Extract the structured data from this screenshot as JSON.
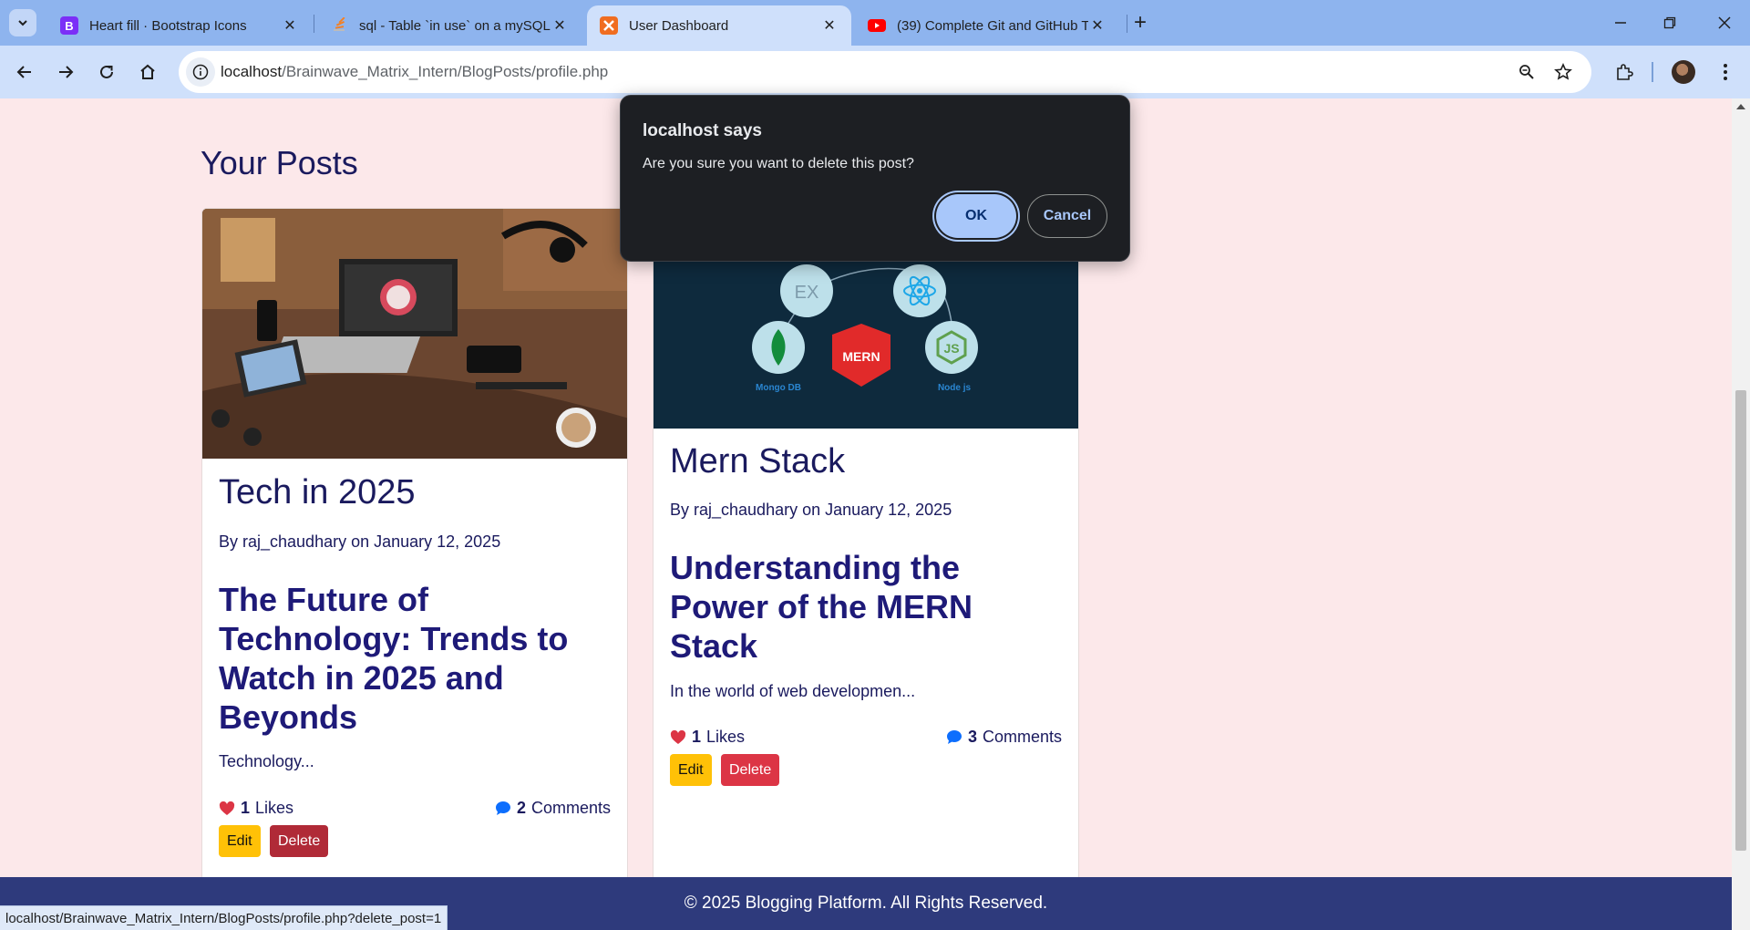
{
  "browser": {
    "tabs": [
      {
        "title": "Heart fill · Bootstrap Icons",
        "favicon": "bootstrap-icon",
        "favicon_letter": "B",
        "favicon_color": "#7b2ff7"
      },
      {
        "title": "sql - Table `in use` on a mySQL",
        "favicon": "stackoverflow-icon",
        "favicon_color": "#f48024"
      },
      {
        "title": "User Dashboard",
        "favicon": "xampp-icon",
        "favicon_color": "#f06d20",
        "active": true
      },
      {
        "title": "(39) Complete Git and GitHub T",
        "favicon": "youtube-icon",
        "favicon_color": "#ff0000"
      }
    ],
    "url_host": "localhost",
    "url_path": "/Brainwave_Matrix_Intern/BlogPosts/profile.php",
    "status_url": "localhost/Brainwave_Matrix_Intern/BlogPosts/profile.php?delete_post=1"
  },
  "page": {
    "section_title": "Your Posts",
    "posts": [
      {
        "title": "Tech in 2025",
        "meta": "By raj_chaudhary on January 12, 2025",
        "heading": "The Future of Technology: Trends to Watch in 2025 and Beyonds",
        "excerpt": "Technology...",
        "likes_count": "1",
        "likes_label": "Likes",
        "comments_count": "2",
        "comments_label": "Comments",
        "edit_label": "Edit",
        "delete_label": "Delete"
      },
      {
        "title": "Mern Stack",
        "meta": "By raj_chaudhary on January 12, 2025",
        "heading": "Understanding the Power of the MERN Stack",
        "excerpt": "In the world of web developmen...",
        "likes_count": "1",
        "likes_label": "Likes",
        "comments_count": "3",
        "comments_label": "Comments",
        "edit_label": "Edit",
        "delete_label": "Delete",
        "image_labels": {
          "ex": "EX",
          "mern": "MERN",
          "mongo": "Mongo DB",
          "node": "Node js",
          "js": "JS"
        }
      }
    ],
    "footer_text": "© 2025 Blogging Platform. All Rights Reserved."
  },
  "dialog": {
    "title": "localhost says",
    "message": "Are you sure you want to delete this post?",
    "ok_label": "OK",
    "cancel_label": "Cancel"
  },
  "colors": {
    "page_bg": "#fce8ea",
    "text_primary": "#1a1a5e",
    "heading": "#1e1a78",
    "edit_button": "#ffc107",
    "delete_button": "#dc3545",
    "footer_bg": "#2e3a7c",
    "heart": "#dc3545",
    "comment": "#0d6efd"
  }
}
